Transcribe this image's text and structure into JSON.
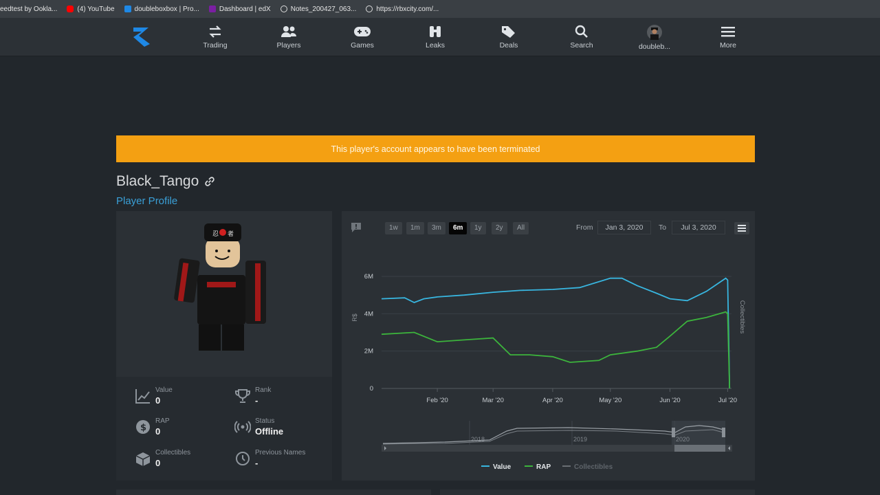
{
  "bookmarks": [
    {
      "label": "eedtest by Ookla...",
      "icon": "ookla-icon",
      "color": "#ffffff"
    },
    {
      "label": "(4) YouTube",
      "icon": "youtube-icon",
      "color": "#ff0000"
    },
    {
      "label": "doubleboxbox | Pro...",
      "icon": "rolimons-icon",
      "color": "#1e88e5"
    },
    {
      "label": "Dashboard | edX",
      "icon": "edx-icon",
      "color": "#7b1fa2"
    },
    {
      "label": "Notes_200427_063...",
      "icon": "globe-icon",
      "color": "#dddddd"
    },
    {
      "label": "https://rbxcity.com/...",
      "icon": "globe-icon",
      "color": "#dddddd"
    }
  ],
  "nav": {
    "items": [
      {
        "label": "Trading",
        "icon": "trade-arrows-icon"
      },
      {
        "label": "Players",
        "icon": "users-icon"
      },
      {
        "label": "Games",
        "icon": "gamepad-icon"
      },
      {
        "label": "Leaks",
        "icon": "binoculars-icon"
      },
      {
        "label": "Deals",
        "icon": "tags-icon"
      },
      {
        "label": "Search",
        "icon": "search-icon"
      },
      {
        "label": "doubleb...",
        "icon": "avatar"
      },
      {
        "label": "More",
        "icon": "hamburger-icon"
      }
    ]
  },
  "banner": {
    "text": "This player's account appears to have been terminated",
    "color": "#f4a012"
  },
  "player": {
    "name": "Black_Tango",
    "subtitle": "Player Profile"
  },
  "stats": {
    "value": {
      "label": "Value",
      "val": "0"
    },
    "rank": {
      "label": "Rank",
      "val": "-"
    },
    "rap": {
      "label": "RAP",
      "val": "0"
    },
    "status": {
      "label": "Status",
      "val": "Offline"
    },
    "collectibles": {
      "label": "Collectibles",
      "val": "0"
    },
    "previous_names": {
      "label": "Previous Names",
      "val": "-"
    }
  },
  "chart_controls": {
    "ranges": [
      "1w",
      "1m",
      "3m",
      "6m",
      "1y",
      "2y",
      "All"
    ],
    "active_range": "6m",
    "from_label": "From",
    "from_date": "Jan 3, 2020",
    "to_label": "To",
    "to_date": "Jul 3, 2020"
  },
  "chart_data": {
    "type": "line",
    "x_ticks": [
      "Feb '20",
      "Mar '20",
      "Apr '20",
      "May '20",
      "Jun '20",
      "Jul '20"
    ],
    "y_ticks": [
      "6M",
      "4M",
      "2M",
      "0"
    ],
    "ylabel": "R$",
    "y2label": "Collectibles",
    "ylim": [
      0,
      6000000
    ],
    "navigator_labels": [
      "2018",
      "2019",
      "2020"
    ],
    "series": [
      {
        "name": "Value",
        "color": "#38b6e0",
        "x": [
          "2020-01-03",
          "2020-01-15",
          "2020-01-20",
          "2020-01-25",
          "2020-02-01",
          "2020-02-15",
          "2020-03-01",
          "2020-03-15",
          "2020-04-01",
          "2020-04-15",
          "2020-05-01",
          "2020-05-07",
          "2020-05-15",
          "2020-05-25",
          "2020-06-01",
          "2020-06-10",
          "2020-06-20",
          "2020-06-30",
          "2020-07-01",
          "2020-07-02"
        ],
        "y": [
          4800000,
          4850000,
          4600000,
          4800000,
          4900000,
          5000000,
          5150000,
          5250000,
          5300000,
          5400000,
          5900000,
          5900000,
          5500000,
          5100000,
          4800000,
          4700000,
          5200000,
          5900000,
          5800000,
          0
        ]
      },
      {
        "name": "RAP",
        "color": "#3cb43c",
        "x": [
          "2020-01-03",
          "2020-01-20",
          "2020-02-01",
          "2020-02-15",
          "2020-03-01",
          "2020-03-10",
          "2020-03-20",
          "2020-04-01",
          "2020-04-10",
          "2020-04-25",
          "2020-05-01",
          "2020-05-15",
          "2020-05-25",
          "2020-06-01",
          "2020-06-10",
          "2020-06-20",
          "2020-06-30",
          "2020-07-01",
          "2020-07-02"
        ],
        "y": [
          2900000,
          3000000,
          2500000,
          2600000,
          2700000,
          1800000,
          1800000,
          1700000,
          1400000,
          1500000,
          1800000,
          2000000,
          2200000,
          2800000,
          3600000,
          3800000,
          4100000,
          4000000,
          0
        ]
      }
    ],
    "legend": [
      "Value",
      "RAP",
      "Collectibles"
    ],
    "legend_colors": [
      "#38b6e0",
      "#3cb43c",
      "#6a6f74"
    ],
    "legend_position": "bottom-center"
  }
}
